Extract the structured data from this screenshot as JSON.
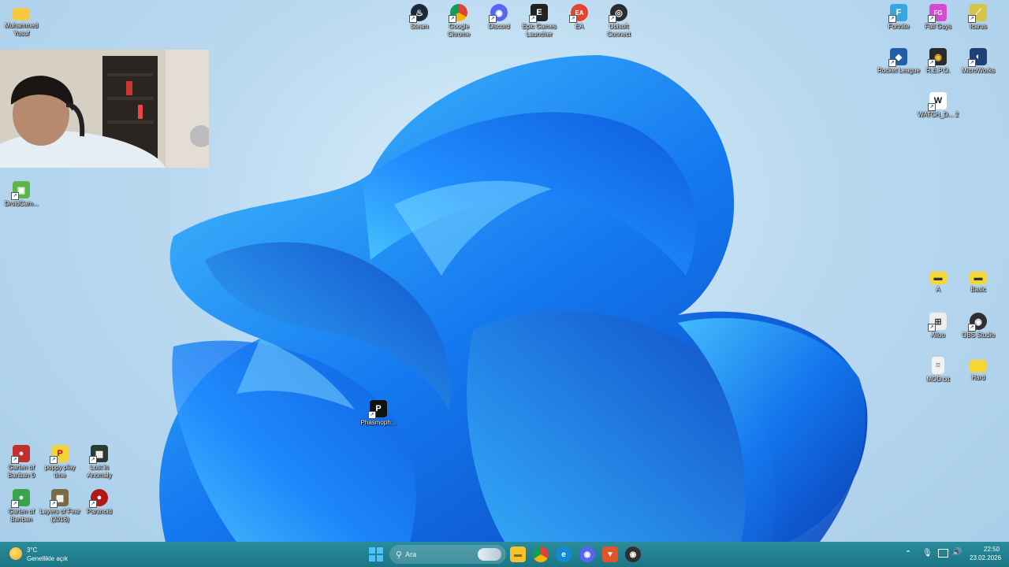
{
  "desktop": {
    "top_icons": [
      {
        "label": "Steam",
        "color": "#1b2838",
        "glyph": "♨"
      },
      {
        "label": "Google Chrome",
        "color": "#db4437",
        "glyph": "●"
      },
      {
        "label": "Discord",
        "color": "#5865f2",
        "glyph": "◉"
      },
      {
        "label": "Epic Games Launcher",
        "color": "#222222",
        "glyph": "E"
      },
      {
        "label": "EA",
        "color": "#e4432d",
        "glyph": "EA"
      },
      {
        "label": "Ubisoft Connect",
        "color": "#2b2b2b",
        "glyph": "◎"
      }
    ],
    "left_icons": [
      {
        "label": "Muhammed Yusuf",
        "color": "#f6c945",
        "glyph": ""
      },
      {
        "label": "DroidCam...",
        "color": "#5bb54a",
        "glyph": "▣"
      }
    ],
    "bottom_left_icons": [
      {
        "label": "Garten of Banban 0",
        "color": "#c2302b",
        "glyph": "●"
      },
      {
        "label": "poppy play time",
        "color": "#f2d43a",
        "glyph": "P"
      },
      {
        "label": "Lost in Anomaly",
        "color": "#2a3b30",
        "glyph": "▦"
      },
      {
        "label": "Garten of Banban",
        "color": "#3aa44a",
        "glyph": "●"
      },
      {
        "label": "Layers of Fear (2016)",
        "color": "#7a6a4a",
        "glyph": "▦"
      },
      {
        "label": "Paranoid",
        "color": "#b01818",
        "glyph": "●"
      }
    ],
    "center_icon": {
      "label": "Phasmoph...",
      "color": "#111111",
      "glyph": "P"
    },
    "right_icons": [
      {
        "label": "Fortnite",
        "color": "#3aa6e0",
        "glyph": "F"
      },
      {
        "label": "Fall Guys",
        "color": "#d44ad0",
        "glyph": "FG"
      },
      {
        "label": "Icarus",
        "color": "#d6c34a",
        "glyph": "⟋"
      },
      {
        "label": "Rocket League",
        "color": "#1e5fa8",
        "glyph": "◆"
      },
      {
        "label": "R.E.P.O.",
        "color": "#2b2b2b",
        "glyph": "◉"
      },
      {
        "label": "MicroWorks",
        "color": "#1e3f7a",
        "glyph": "◐"
      },
      {
        "label": "WATCH_D... 2",
        "color": "#ffffff",
        "glyph": "W"
      },
      {
        "label": "A",
        "color": "#f4d634",
        "glyph": "▬"
      },
      {
        "label": "Basic",
        "color": "#f4d634",
        "glyph": "▬"
      },
      {
        "label": "Alloo",
        "color": "#eeeeee",
        "glyph": "⊞"
      },
      {
        "label": "OBS Studio",
        "color": "#302e31",
        "glyph": "◉"
      },
      {
        "label": "MOD.txt",
        "color": "#f2f2f2",
        "glyph": "≡"
      },
      {
        "label": "Hard",
        "color": "#f4d634",
        "glyph": ""
      }
    ]
  },
  "taskbar": {
    "weather_temp": "3°C",
    "weather_desc": "Genellikle açık",
    "search_placeholder": "Ara",
    "apps": [
      {
        "name": "file-explorer-icon",
        "color": "#f4c430",
        "glyph": "▬"
      },
      {
        "name": "chrome-icon",
        "color": "#db4437",
        "glyph": "●"
      },
      {
        "name": "edge-icon",
        "color": "#0f8bd6",
        "glyph": "e"
      },
      {
        "name": "discord-icon",
        "color": "#5865f2",
        "glyph": "◉"
      },
      {
        "name": "brave-icon",
        "color": "#e2532a",
        "glyph": "▼"
      },
      {
        "name": "obs-icon",
        "color": "#302e31",
        "glyph": "◉"
      }
    ],
    "time": "22:50",
    "date": "23.02.2026"
  }
}
